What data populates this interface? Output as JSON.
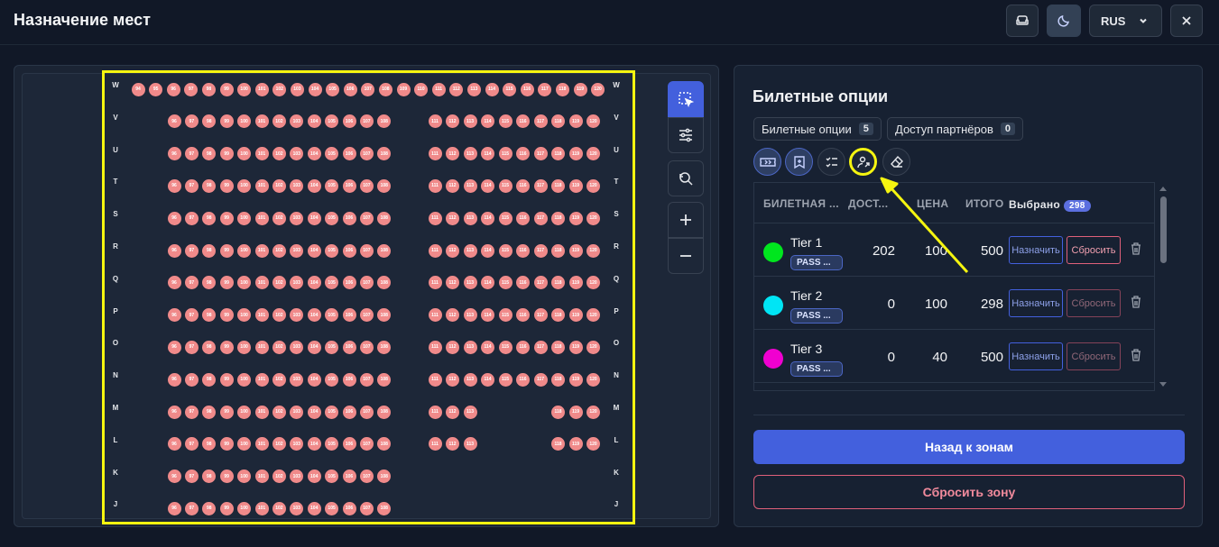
{
  "header": {
    "title": "Назначение мест",
    "language": "RUS"
  },
  "seat_map": {
    "rows": [
      {
        "label": "W",
        "seats": [
          "94",
          "95",
          "96",
          "97",
          "98",
          "99",
          "100",
          "101",
          "102",
          "103",
          "104",
          "105",
          "106",
          "107",
          "108",
          "109",
          "110",
          "111",
          "112",
          "113",
          "114",
          "115",
          "116",
          "117",
          "118",
          "119",
          "120"
        ]
      },
      {
        "label": "V",
        "seats": [
          "96",
          "97",
          "98",
          "99",
          "100",
          "101",
          "102",
          "103",
          "104",
          "105",
          "106",
          "107",
          "108",
          "111",
          "112",
          "113",
          "114",
          "115",
          "116",
          "117",
          "118",
          "119",
          "120"
        ]
      },
      {
        "label": "U",
        "seats": [
          "96",
          "97",
          "98",
          "99",
          "100",
          "101",
          "102",
          "103",
          "104",
          "105",
          "106",
          "107",
          "108",
          "111",
          "112",
          "113",
          "114",
          "115",
          "116",
          "117",
          "118",
          "119",
          "120"
        ]
      },
      {
        "label": "T",
        "seats": [
          "96",
          "97",
          "98",
          "99",
          "100",
          "101",
          "102",
          "103",
          "104",
          "105",
          "106",
          "107",
          "108",
          "111",
          "112",
          "113",
          "114",
          "115",
          "116",
          "117",
          "118",
          "119",
          "120"
        ]
      },
      {
        "label": "S",
        "seats": [
          "96",
          "97",
          "98",
          "99",
          "100",
          "101",
          "102",
          "103",
          "104",
          "105",
          "106",
          "107",
          "108",
          "111",
          "112",
          "113",
          "114",
          "115",
          "116",
          "117",
          "118",
          "119",
          "120"
        ]
      },
      {
        "label": "R",
        "seats": [
          "96",
          "97",
          "98",
          "99",
          "100",
          "101",
          "102",
          "103",
          "104",
          "105",
          "106",
          "107",
          "108",
          "111",
          "112",
          "113",
          "114",
          "115",
          "116",
          "117",
          "118",
          "119",
          "120"
        ]
      },
      {
        "label": "Q",
        "seats": [
          "96",
          "97",
          "98",
          "99",
          "100",
          "101",
          "102",
          "103",
          "104",
          "105",
          "106",
          "107",
          "108",
          "111",
          "112",
          "113",
          "114",
          "115",
          "116",
          "117",
          "118",
          "119",
          "120"
        ]
      },
      {
        "label": "P",
        "seats": [
          "96",
          "97",
          "98",
          "99",
          "100",
          "101",
          "102",
          "103",
          "104",
          "105",
          "106",
          "107",
          "108",
          "111",
          "112",
          "113",
          "114",
          "115",
          "116",
          "117",
          "118",
          "119",
          "120"
        ]
      },
      {
        "label": "O",
        "seats": [
          "96",
          "97",
          "98",
          "99",
          "100",
          "101",
          "102",
          "103",
          "104",
          "105",
          "106",
          "107",
          "108",
          "111",
          "112",
          "113",
          "114",
          "115",
          "116",
          "117",
          "118",
          "119",
          "120"
        ]
      },
      {
        "label": "N",
        "seats": [
          "96",
          "97",
          "98",
          "99",
          "100",
          "101",
          "102",
          "103",
          "104",
          "105",
          "106",
          "107",
          "108",
          "111",
          "112",
          "113",
          "114",
          "115",
          "116",
          "117",
          "118",
          "119",
          "120"
        ]
      },
      {
        "label": "M",
        "seats": [
          "96",
          "97",
          "98",
          "99",
          "100",
          "101",
          "102",
          "103",
          "104",
          "105",
          "106",
          "107",
          "108",
          "111",
          "112",
          "113",
          "118",
          "119",
          "120"
        ]
      },
      {
        "label": "L",
        "seats": [
          "96",
          "97",
          "98",
          "99",
          "100",
          "101",
          "102",
          "103",
          "104",
          "105",
          "106",
          "107",
          "108",
          "111",
          "112",
          "113",
          "118",
          "119",
          "120"
        ]
      },
      {
        "label": "K",
        "seats": [
          "96",
          "97",
          "98",
          "99",
          "100",
          "101",
          "102",
          "103",
          "104",
          "105",
          "106",
          "107",
          "108"
        ]
      },
      {
        "label": "J",
        "seats": [
          "96",
          "97",
          "98",
          "99",
          "100",
          "101",
          "102",
          "103",
          "104",
          "105",
          "106",
          "107",
          "108"
        ]
      }
    ]
  },
  "panel": {
    "title": "Билетные опции",
    "chips": [
      {
        "label": "Билетные опции",
        "count": "5"
      },
      {
        "label": "Доступ партнёров",
        "count": "0"
      }
    ],
    "headers": {
      "name": "БИЛЕТНАЯ ...",
      "available": "ДОСТ...",
      "price": "ЦЕНА",
      "total": "ИТОГО",
      "selected": "Выбрано",
      "selected_count": "298"
    },
    "tiers": [
      {
        "name": "Tier 1",
        "tag": "PASS ...",
        "available": "202",
        "price": "100",
        "total": "500",
        "color": "#00e61e",
        "assign": "Назначить",
        "reset": "Сбросить"
      },
      {
        "name": "Tier 2",
        "tag": "PASS ...",
        "available": "0",
        "price": "100",
        "total": "298",
        "color": "#00e5f5",
        "assign": "Назначить",
        "reset": "Сбросить"
      },
      {
        "name": "Tier 3",
        "tag": "PASS ...",
        "available": "0",
        "price": "40",
        "total": "500",
        "color": "#f000d0",
        "assign": "Назначить",
        "reset": "Сбросить"
      }
    ],
    "back_button": "Назад к зонам",
    "reset_zone_button": "Сбросить зону"
  },
  "colors": {
    "seat": "#f08a8a",
    "accent": "#4360dd",
    "highlight": "#f5f510"
  }
}
